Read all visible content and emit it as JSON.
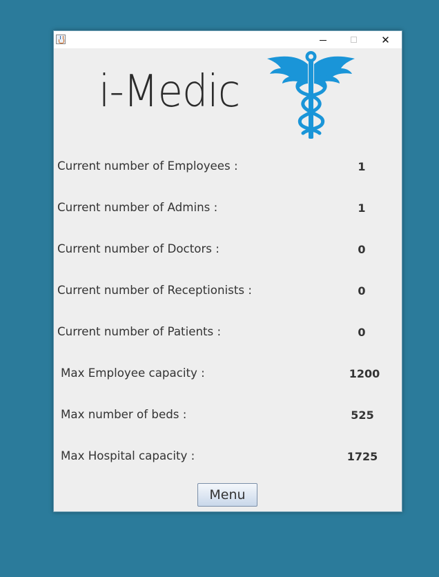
{
  "app": {
    "logo_text": "i-Medic",
    "brand_color": "#1a95d8",
    "background_color": "#2b7b9b"
  },
  "titlebar": {
    "icon": "java-icon",
    "controls": [
      "minimize-icon",
      "maximize-icon",
      "close-icon"
    ],
    "close_glyph": "✕"
  },
  "stats": [
    {
      "label": "Current number of Employees :",
      "value": "1"
    },
    {
      "label": "Current number of Admins :",
      "value": "1"
    },
    {
      "label": "Current number of Doctors :",
      "value": "0"
    },
    {
      "label": "Current number of Receptionists :",
      "value": "0"
    },
    {
      "label": "Current number of Patients :",
      "value": "0"
    },
    {
      "label": "Max Employee capacity :",
      "value": "1200"
    },
    {
      "label": "Max number of beds :",
      "value": "525"
    },
    {
      "label": "Max Hospital capacity :",
      "value": "1725"
    }
  ],
  "menu_button_label": "Menu"
}
